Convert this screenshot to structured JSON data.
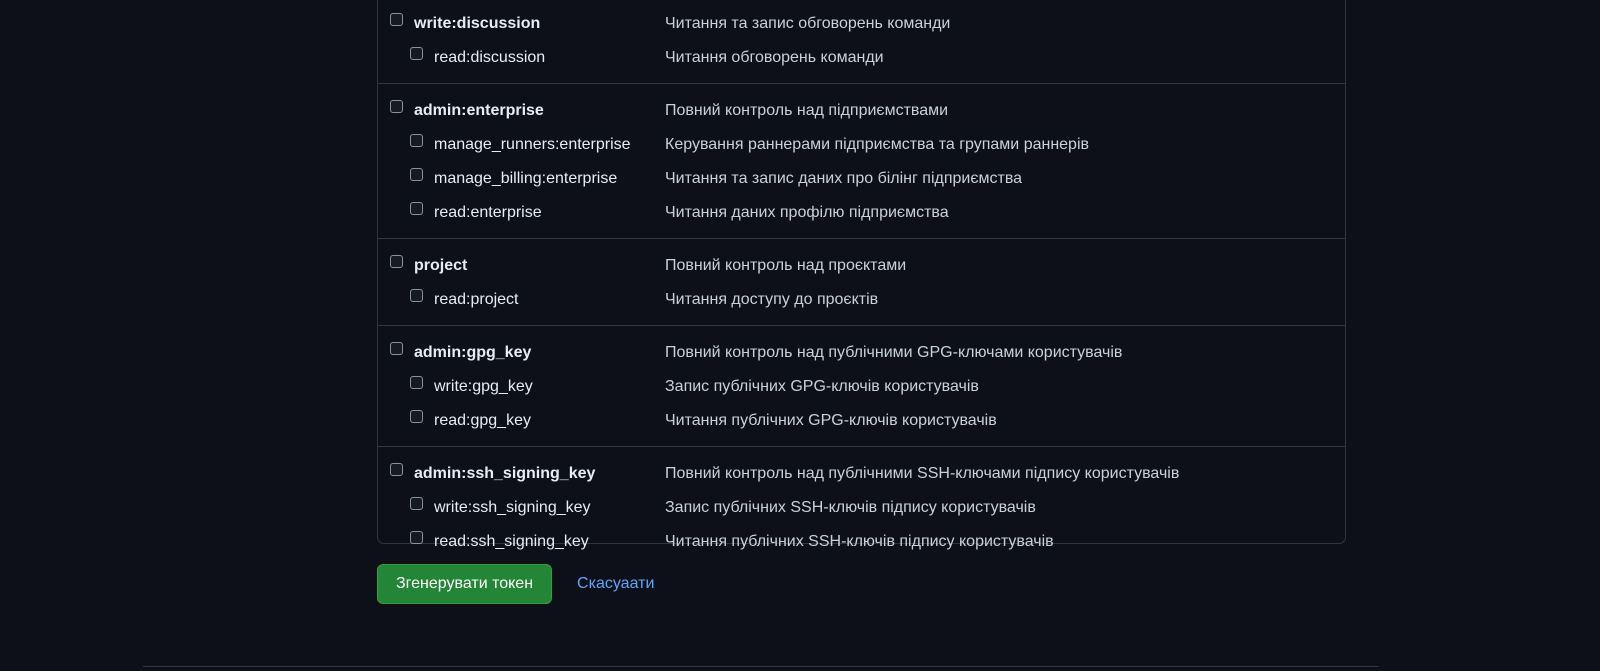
{
  "scope_groups": [
    {
      "parent": {
        "name": "write:discussion",
        "description": "Читання та запис обговорень команди",
        "checked": false
      },
      "children": [
        {
          "name": "read:discussion",
          "description": "Читання обговорень команди",
          "checked": false
        }
      ]
    },
    {
      "parent": {
        "name": "admin:enterprise",
        "description": "Повний контроль над підприємствами",
        "checked": false
      },
      "children": [
        {
          "name": "manage_runners:enterprise",
          "description": "Керування раннерами підприємства та групами раннерів",
          "checked": false
        },
        {
          "name": "manage_billing:enterprise",
          "description": "Читання та запис даних про білінг підприємства",
          "checked": false
        },
        {
          "name": "read:enterprise",
          "description": "Читання даних профілю підприємства",
          "checked": false
        }
      ]
    },
    {
      "parent": {
        "name": "project",
        "description": "Повний контроль над проєктами",
        "checked": false
      },
      "children": [
        {
          "name": "read:project",
          "description": "Читання доступу до проєктів",
          "checked": false
        }
      ]
    },
    {
      "parent": {
        "name": "admin:gpg_key",
        "description": "Повний контроль над публічними GPG-ключами користувачів",
        "checked": false
      },
      "children": [
        {
          "name": "write:gpg_key",
          "description": "Запис публічних GPG-ключів користувачів",
          "checked": false
        },
        {
          "name": "read:gpg_key",
          "description": "Читання публічних GPG-ключів користувачів",
          "checked": false
        }
      ]
    },
    {
      "parent": {
        "name": "admin:ssh_signing_key",
        "description": "Повний контроль над публічними SSH-ключами підпису користувачів",
        "checked": false
      },
      "children": [
        {
          "name": "write:ssh_signing_key",
          "description": "Запис публічних SSH-ключів підпису користувачів",
          "checked": false
        },
        {
          "name": "read:ssh_signing_key",
          "description": "Читання публічних SSH-ключів підпису користувачів",
          "checked": false
        }
      ]
    }
  ],
  "actions": {
    "generate_label": "Згенерувати токен",
    "cancel_label": "Скасуаати"
  },
  "colors": {
    "background": "#0d1117",
    "border": "#30363d",
    "primary_button": "#238636",
    "link": "#58a6ff"
  }
}
